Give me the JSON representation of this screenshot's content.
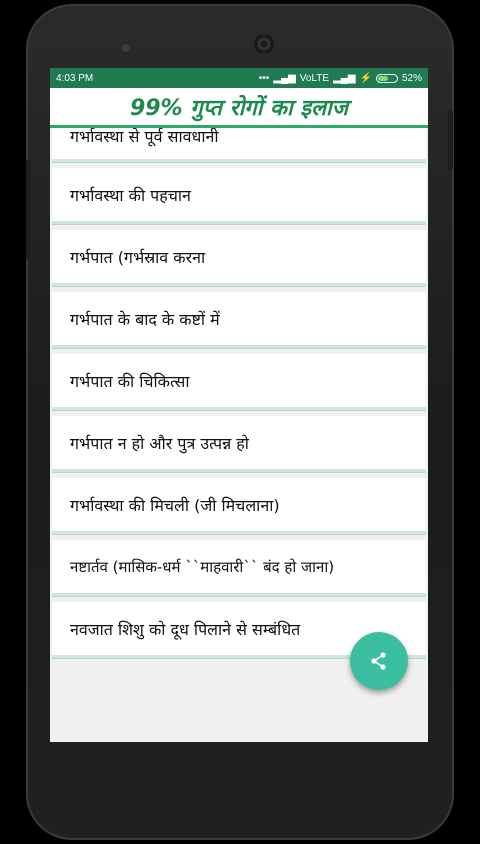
{
  "status": {
    "time": "4:03 PM",
    "network": "VoLTE",
    "battery": "52%"
  },
  "app": {
    "title": "99% गुप्त रोगों का इलाज"
  },
  "list": {
    "items": [
      {
        "label": "गर्भावस्था से पूर्व सावधानी"
      },
      {
        "label": "गर्भावस्था की पहचान"
      },
      {
        "label": "गर्भपात (गर्भस्राव करना"
      },
      {
        "label": "गर्भपात के बाद के कष्टों में"
      },
      {
        "label": "गर्भपात की चिकित्सा"
      },
      {
        "label": "गर्भपात न हो और पुत्र उत्पन्न हो"
      },
      {
        "label": "गर्भावस्था की मिचली (जी मिचलाना)"
      },
      {
        "label": "नष्टार्तव (मासिक-धर्म ``माहवारी`` बंद हो जाना)"
      },
      {
        "label": "नवजात शिशु को दूध पिलाने से सम्बंधित"
      }
    ]
  },
  "colors": {
    "status_bar": "#207a52",
    "title": "#1f8a4f",
    "fab": "#3bbfa0"
  },
  "icons": {
    "fab": "share-icon"
  }
}
